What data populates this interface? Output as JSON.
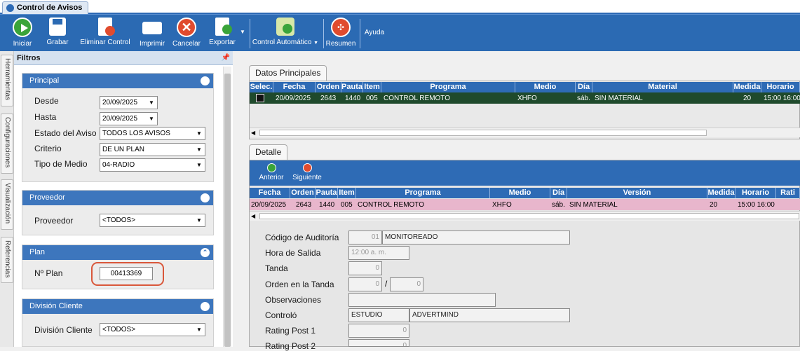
{
  "window": {
    "title": "Control de Avisos"
  },
  "toolbar": {
    "buttons": [
      {
        "label": "Iniciar",
        "icon": "play-icon",
        "color": "#3aa43a"
      },
      {
        "label": "Grabar",
        "icon": "save-icon",
        "color": "#ffffff"
      },
      {
        "label": "Eliminar Control",
        "icon": "delete-document-icon",
        "color": "#e04b2e"
      },
      {
        "label": "Imprimir",
        "icon": "printer-icon",
        "color": "#ffffff"
      },
      {
        "label": "Cancelar",
        "icon": "cancel-icon",
        "color": "#e04b2e"
      },
      {
        "label": "Exportar",
        "icon": "export-icon",
        "color": "#3aa43a"
      },
      {
        "label": "Control Automático",
        "icon": "auto-control-icon",
        "color": "#3aa43a"
      },
      {
        "label": "Resumen",
        "icon": "summary-icon",
        "color": "#e04b2e"
      }
    ],
    "ayuda": "Ayuda"
  },
  "vtabs": [
    "Herramientas",
    "Configuraciones",
    "Visualización",
    "Referencias"
  ],
  "filtros": {
    "title": "Filtros",
    "principal": {
      "title": "Principal",
      "desde_label": "Desde",
      "desde_value": "20/09/2025",
      "hasta_label": "Hasta",
      "hasta_value": "20/09/2025",
      "estado_label": "Estado del Aviso",
      "estado_value": "TODOS LOS AVISOS",
      "criterio_label": "Criterio",
      "criterio_value": "DE UN PLAN",
      "medio_label": "Tipo de Medio",
      "medio_value": "04-RADIO"
    },
    "proveedor": {
      "title": "Proveedor",
      "label": "Proveedor",
      "value": "<TODOS>"
    },
    "plan": {
      "title": "Plan",
      "label": "Nº Plan",
      "value": "00413369"
    },
    "division": {
      "title": "División Cliente",
      "label": "División Cliente",
      "value": "<TODOS>"
    }
  },
  "datos_principales": {
    "tab": "Datos Principales",
    "columns": [
      "Selec.",
      "Fecha",
      "Orden",
      "Pauta",
      "Item",
      "Programa",
      "Medio",
      "Día",
      "Material",
      "Medida",
      "Horario"
    ],
    "row": {
      "fecha": "20/09/2025",
      "orden": "2643",
      "pauta": "1440",
      "item": "005",
      "programa": "CONTROL REMOTO",
      "medio": "XHFO",
      "dia": "sáb.",
      "material": "SIN MATERIAL",
      "medida": "20",
      "horario": "15:00 16:00"
    }
  },
  "detalle": {
    "tab": "Detalle",
    "anterior": "Anterior",
    "siguiente": "Siguiente",
    "columns": [
      "Fecha",
      "Orden",
      "Pauta",
      "Item",
      "Programa",
      "Medio",
      "Día",
      "Versión",
      "Medida",
      "Horario",
      "Rati"
    ],
    "row": {
      "fecha": "20/09/2025",
      "orden": "2643",
      "pauta": "1440",
      "item": "005",
      "programa": "CONTROL REMOTO",
      "medio": "XHFO",
      "dia": "sáb.",
      "version": "SIN MATERIAL",
      "medida": "20",
      "horario": "15:00 16:00"
    },
    "row_color": "#e8b6cc",
    "fields": {
      "codigo_label": "Código de Auditoría",
      "codigo_num": "01",
      "codigo_text": "MONITOREADO",
      "hora_label": "Hora de Salida",
      "hora_value": "12:00 a. m.",
      "tanda_label": "Tanda",
      "tanda_value": "0",
      "orden_label": "Orden en la Tanda",
      "orden_a": "0",
      "orden_sep": "/",
      "orden_b": "0",
      "obs_label": "Observaciones",
      "controlo_label": "Controló",
      "controlo_a": "ESTUDIO",
      "controlo_b": "ADVERTMIND",
      "rating1_label": "Rating Post 1",
      "rating1_value": "0",
      "rating2_label": "Rating Post 2",
      "rating2_value": "0"
    }
  }
}
